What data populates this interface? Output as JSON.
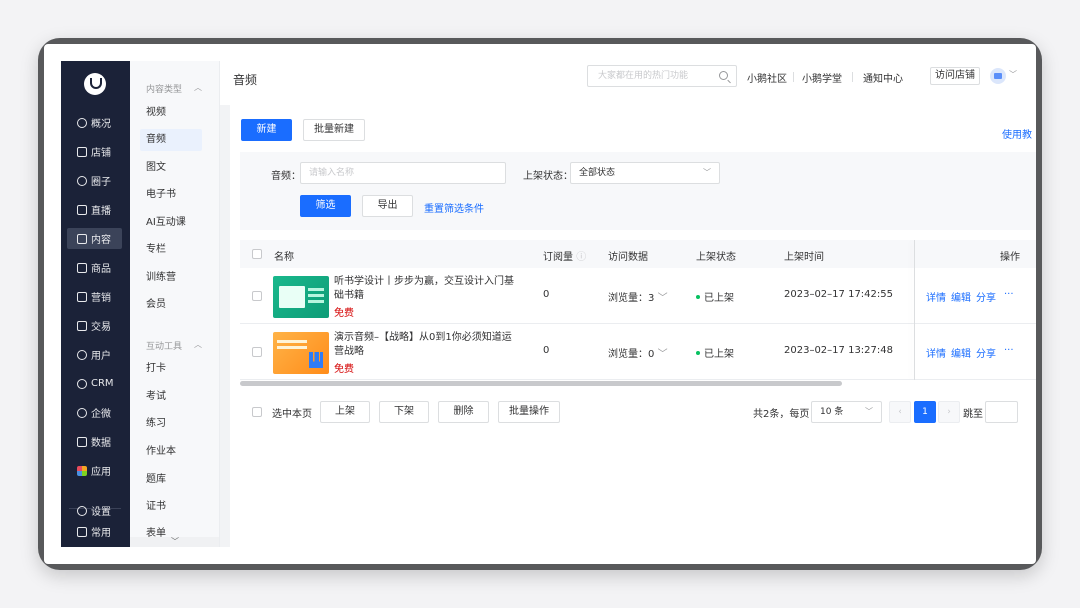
{
  "nav": {
    "items": [
      {
        "label": "概况",
        "icon": "overview-icon"
      },
      {
        "label": "店铺",
        "icon": "store-icon"
      },
      {
        "label": "圈子",
        "icon": "community-icon"
      },
      {
        "label": "直播",
        "icon": "live-icon"
      },
      {
        "label": "内容",
        "icon": "content-icon",
        "active": true
      },
      {
        "label": "商品",
        "icon": "goods-icon"
      },
      {
        "label": "营销",
        "icon": "marketing-icon"
      },
      {
        "label": "交易",
        "icon": "trade-icon"
      },
      {
        "label": "用户",
        "icon": "user-icon"
      },
      {
        "label": "CRM",
        "icon": "crm-icon"
      },
      {
        "label": "企微",
        "icon": "wecom-icon"
      },
      {
        "label": "数据",
        "icon": "data-icon"
      },
      {
        "label": "应用",
        "icon": "apps-icon"
      }
    ],
    "settings": "设置",
    "common": "常用"
  },
  "submenu": {
    "group1": "内容类型",
    "items1": [
      "视频",
      "音频",
      "图文",
      "电子书",
      "AI互动课",
      "专栏",
      "训练营",
      "会员"
    ],
    "group2": "互动工具",
    "items2": [
      "打卡",
      "考试",
      "练习",
      "作业本",
      "题库",
      "证书",
      "表单"
    ]
  },
  "topbar": {
    "title": "音频",
    "search_placeholder": "大家都在用的热门功能",
    "links": [
      "小鹅社区",
      "小鹅学堂",
      "通知中心"
    ],
    "visit_store": "访问店铺"
  },
  "toolbar": {
    "new": "新建",
    "batch_new": "批量新建",
    "help": "使用教"
  },
  "filter": {
    "audio_label": "音频：",
    "audio_placeholder": "请输入名称",
    "status_label": "上架状态：",
    "status_value": "全部状态",
    "filter_btn": "筛选",
    "export_btn": "导出",
    "reset_link": "重置筛选条件"
  },
  "table": {
    "headers": {
      "name": "名称",
      "subs": "订阅量",
      "visits": "访问数据",
      "status": "上架状态",
      "time": "上架时间",
      "ops": "操作"
    },
    "rows": [
      {
        "title": "听书学设计丨步步为赢，交互设计入门基础书籍",
        "price": "免费",
        "subs": "0",
        "views": "浏览量：3",
        "status": "已上架",
        "time": "2023–02–17 17:42:55",
        "thumb": "green"
      },
      {
        "title": "演示音频–【战略】从0到1你必须知道运营战略",
        "price": "免费",
        "subs": "0",
        "views": "浏览量：0",
        "status": "已上架",
        "time": "2023–02–17 13:27:48",
        "thumb": "orange"
      }
    ],
    "ops": [
      "详情",
      "编辑",
      "分享"
    ]
  },
  "footer": {
    "select_page": "选中本页",
    "up": "上架",
    "down": "下架",
    "delete": "删除",
    "batch": "批量操作",
    "total": "共2条，每页",
    "page_size": "10 条",
    "current_page": "1",
    "jump": "跳至"
  },
  "colors": {
    "primary": "#1a6dff",
    "nav_bg": "#1b2238",
    "status_green": "#07c160",
    "price_red": "#d40000"
  }
}
